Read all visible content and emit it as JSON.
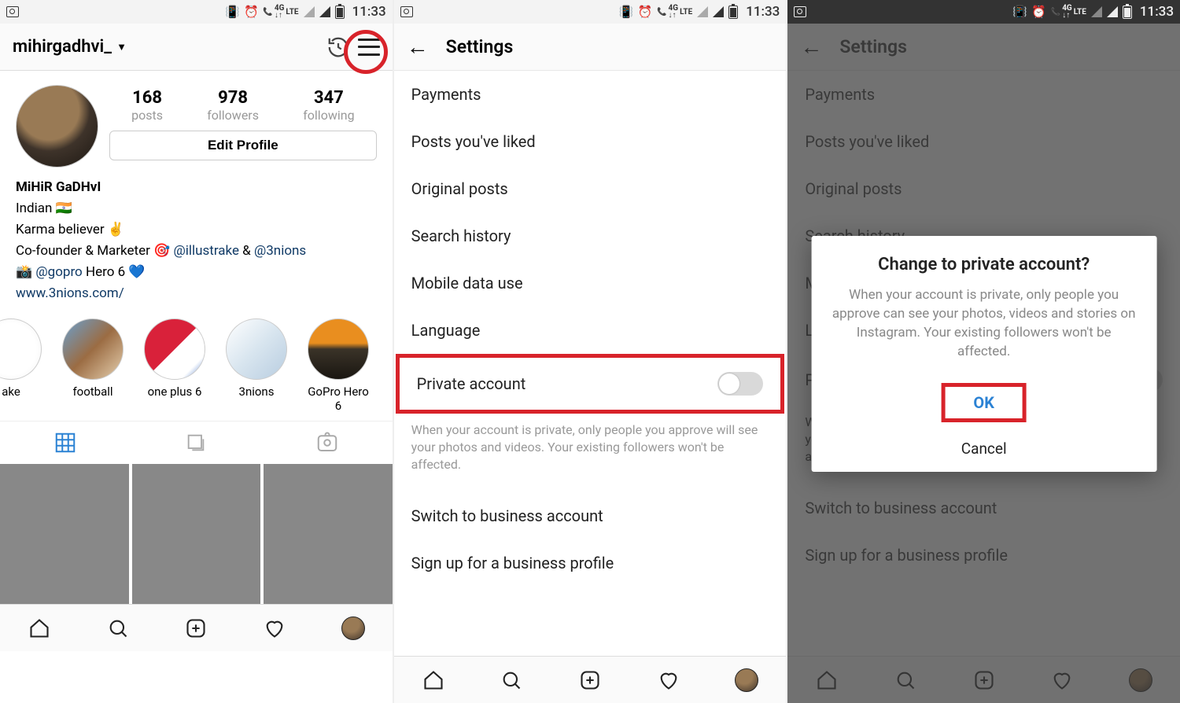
{
  "status": {
    "time": "11:33",
    "lte_top": "4G",
    "lte_mid": "LTE",
    "lte_arrows": "↓↑"
  },
  "screen1": {
    "handle": "mihirgadhvi_",
    "stats": {
      "posts_n": "168",
      "posts_l": "posts",
      "followers_n": "978",
      "followers_l": "followers",
      "following_n": "347",
      "following_l": "following"
    },
    "edit_label": "Edit Profile",
    "bio": {
      "fullname": "MiHiR GaDHvI",
      "line2a": "Indian ",
      "line2b": "🇮🇳",
      "line3a": "Karma believer ",
      "line3b": "✌️",
      "line4a": "Co-founder & Marketer 🎯 ",
      "mention1": "@illustrake",
      "amp": " & ",
      "mention2": "@3nions",
      "line5a": "📸 ",
      "mention3": "@gopro",
      "line5b": " Hero 6 ",
      "heart": "💙",
      "website": "www.3nions.com/"
    },
    "highlights": [
      {
        "label": "ake"
      },
      {
        "label": "football"
      },
      {
        "label": "one plus 6"
      },
      {
        "label": "3nions"
      },
      {
        "label": "GoPro Hero 6"
      }
    ]
  },
  "settings": {
    "title": "Settings",
    "items": {
      "payments": "Payments",
      "liked": "Posts you've liked",
      "original": "Original posts",
      "search": "Search history",
      "mobile": "Mobile data use",
      "language": "Language",
      "private": "Private account",
      "switchbiz": "Switch to business account",
      "signupbiz": "Sign up for a business profile"
    },
    "private_desc": "When your account is private, only people you approve will see your photos and videos. Your existing followers won't be affected."
  },
  "dialog": {
    "title": "Change to private account?",
    "body": "When your account is private, only people you approve can see your photos, videos and stories on Instagram. Your existing followers won't be affected.",
    "ok": "OK",
    "cancel": "Cancel"
  }
}
